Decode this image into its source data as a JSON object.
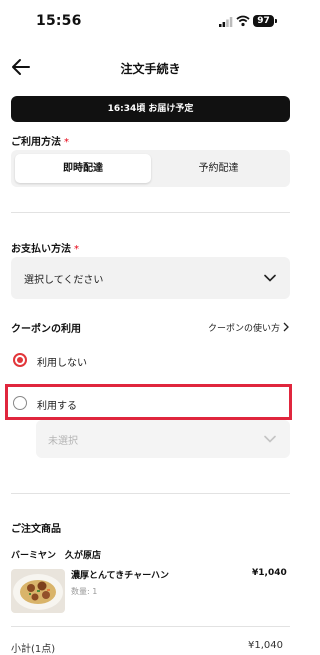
{
  "status_bar": {
    "time": "15:56",
    "battery": "97"
  },
  "header": {
    "title": "注文手続き"
  },
  "banner": {
    "text": "16:34頃 お届け予定"
  },
  "usage": {
    "label": "ご利用方法",
    "required_mark": "*",
    "options": [
      "即時配達",
      "予約配達"
    ],
    "selected": "即時配達"
  },
  "payment": {
    "label": "お支払い方法",
    "required_mark": "*",
    "placeholder": "選択してください"
  },
  "coupon": {
    "label": "クーポンの利用",
    "help_link": "クーポンの使い方",
    "options": [
      "利用しない",
      "利用する"
    ],
    "selected": "利用しない",
    "select_placeholder": "未選択"
  },
  "order": {
    "label": "ご注文商品",
    "store": "バーミヤン　久が原店",
    "items": [
      {
        "name": "濃厚とんてきチャーハン",
        "qty": "数量: 1",
        "price": "¥1,040"
      }
    ],
    "subtotal_label": "小計(1点)",
    "subtotal_value": "¥1,040"
  },
  "colors": {
    "accent": "#e2363a",
    "highlight": "#e0263d",
    "banner": "#111111"
  }
}
